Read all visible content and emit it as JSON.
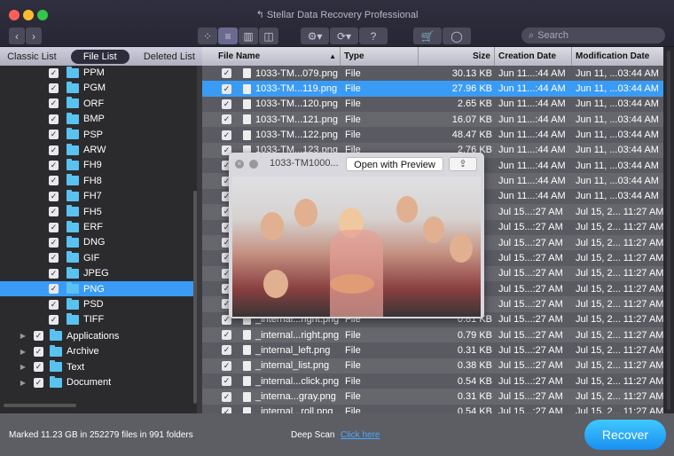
{
  "window": {
    "title": "Stellar Data Recovery Professional",
    "traffic_colors": [
      "#fc5f57",
      "#fdbc2e",
      "#33c748"
    ]
  },
  "toolbar": {
    "icons": [
      "chevron-left-icon",
      "chevron-right-icon",
      "icon-view-icon",
      "list-view-icon",
      "column-view-icon",
      "coverflow-view-icon",
      "gear-icon",
      "recovery-history-icon",
      "help-icon",
      "cart-icon",
      "user-icon"
    ],
    "help_label": "?",
    "search_placeholder": "Search"
  },
  "sidebar": {
    "tabs": [
      "Classic List",
      "File List",
      "Deleted List"
    ],
    "active_tab": "File List",
    "items": [
      "PPM",
      "PGM",
      "ORF",
      "BMP",
      "PSP",
      "ARW",
      "FH9",
      "FH8",
      "FH7",
      "FH5",
      "ERF",
      "DNG",
      "GIF",
      "JPEG",
      "PNG",
      "PSD",
      "TIFF"
    ],
    "selected": "PNG",
    "groups": [
      "Applications",
      "Archive",
      "Text",
      "Document"
    ]
  },
  "table": {
    "columns": [
      "File Name",
      "Type",
      "Size",
      "Creation Date",
      "Modification Date"
    ],
    "sort": "File Name ascending",
    "rows": [
      {
        "name": "1033-TM...079.png",
        "type": "File",
        "size": "30.13 KB",
        "created": "Jun 11...:44 AM",
        "modified": "Jun 11, ...03:44 AM"
      },
      {
        "name": "1033-TM...119.png",
        "type": "File",
        "size": "27.96 KB",
        "created": "Jun 11...:44 AM",
        "modified": "Jun 11, ...03:44 AM",
        "selected": true
      },
      {
        "name": "1033-TM...120.png",
        "type": "File",
        "size": "2.65 KB",
        "created": "Jun 11...:44 AM",
        "modified": "Jun 11, ...03:44 AM"
      },
      {
        "name": "1033-TM...121.png",
        "type": "File",
        "size": "16.07 KB",
        "created": "Jun 11...:44 AM",
        "modified": "Jun 11, ...03:44 AM"
      },
      {
        "name": "1033-TM...122.png",
        "type": "File",
        "size": "48.47 KB",
        "created": "Jun 11...:44 AM",
        "modified": "Jun 11, ...03:44 AM"
      },
      {
        "name": "1033-TM...123.png",
        "type": "File",
        "size": "2.76 KB",
        "created": "Jun 11...:44 AM",
        "modified": "Jun 11, ...03:44 AM"
      },
      {
        "name": "",
        "type": "",
        "size": "",
        "created": "Jun 11...:44 AM",
        "modified": "Jun 11, ...03:44 AM"
      },
      {
        "name": "",
        "type": "",
        "size": "",
        "created": "Jun 11...:44 AM",
        "modified": "Jun 11, ...03:44 AM"
      },
      {
        "name": "",
        "type": "",
        "size": "",
        "created": "Jun 11...:44 AM",
        "modified": "Jun 11, ...03:44 AM"
      },
      {
        "name": "",
        "type": "",
        "size": "",
        "created": "Jul 15...:27 AM",
        "modified": "Jul 15, 2... 11:27 AM"
      },
      {
        "name": "",
        "type": "",
        "size": "",
        "created": "Jul 15...:27 AM",
        "modified": "Jul 15, 2... 11:27 AM"
      },
      {
        "name": "",
        "type": "",
        "size": "",
        "created": "Jul 15...:27 AM",
        "modified": "Jul 15, 2... 11:27 AM"
      },
      {
        "name": "",
        "type": "",
        "size": "",
        "created": "Jul 15...:27 AM",
        "modified": "Jul 15, 2... 11:27 AM"
      },
      {
        "name": "",
        "type": "",
        "size": "",
        "created": "Jul 15...:27 AM",
        "modified": "Jul 15, 2... 11:27 AM"
      },
      {
        "name": "",
        "type": "",
        "size": "",
        "created": "Jul 15...:27 AM",
        "modified": "Jul 15, 2... 11:27 AM"
      },
      {
        "name": "",
        "type": "",
        "size": "",
        "created": "Jul 15...:27 AM",
        "modified": "Jul 15, 2... 11:27 AM"
      },
      {
        "name": "_internal...right.png",
        "type": "File",
        "size": "0.81 KB",
        "created": "Jul 15...:27 AM",
        "modified": "Jul 15, 2... 11:27 AM"
      },
      {
        "name": "_internal...right.png",
        "type": "File",
        "size": "0.79 KB",
        "created": "Jul 15...:27 AM",
        "modified": "Jul 15, 2... 11:27 AM"
      },
      {
        "name": "_internal_left.png",
        "type": "File",
        "size": "0.31 KB",
        "created": "Jul 15...:27 AM",
        "modified": "Jul 15, 2... 11:27 AM"
      },
      {
        "name": "_internal_list.png",
        "type": "File",
        "size": "0.38 KB",
        "created": "Jul 15...:27 AM",
        "modified": "Jul 15, 2... 11:27 AM"
      },
      {
        "name": "_internal...click.png",
        "type": "File",
        "size": "0.54 KB",
        "created": "Jul 15...:27 AM",
        "modified": "Jul 15, 2... 11:27 AM"
      },
      {
        "name": "_interna...gray.png",
        "type": "File",
        "size": "0.31 KB",
        "created": "Jul 15...:27 AM",
        "modified": "Jul 15, 2... 11:27 AM"
      },
      {
        "name": "_internal...roll.png",
        "type": "File",
        "size": "0.54 KB",
        "created": "Jul 15...:27 AM",
        "modified": "Jul 15, 2... 11:27 AM"
      }
    ]
  },
  "preview": {
    "filename": "1033-TM1000...",
    "open_button": "Open with Preview"
  },
  "status": {
    "marked": "Marked 11.23 GB in 252279 files in 991 folders",
    "deep_scan_label": "Deep Scan",
    "deep_scan_link": "Click here",
    "recover_label": "Recover"
  },
  "colors": {
    "accent": "#3a9bf5",
    "folder": "#5ac2f0",
    "link": "#4aa8ff"
  }
}
